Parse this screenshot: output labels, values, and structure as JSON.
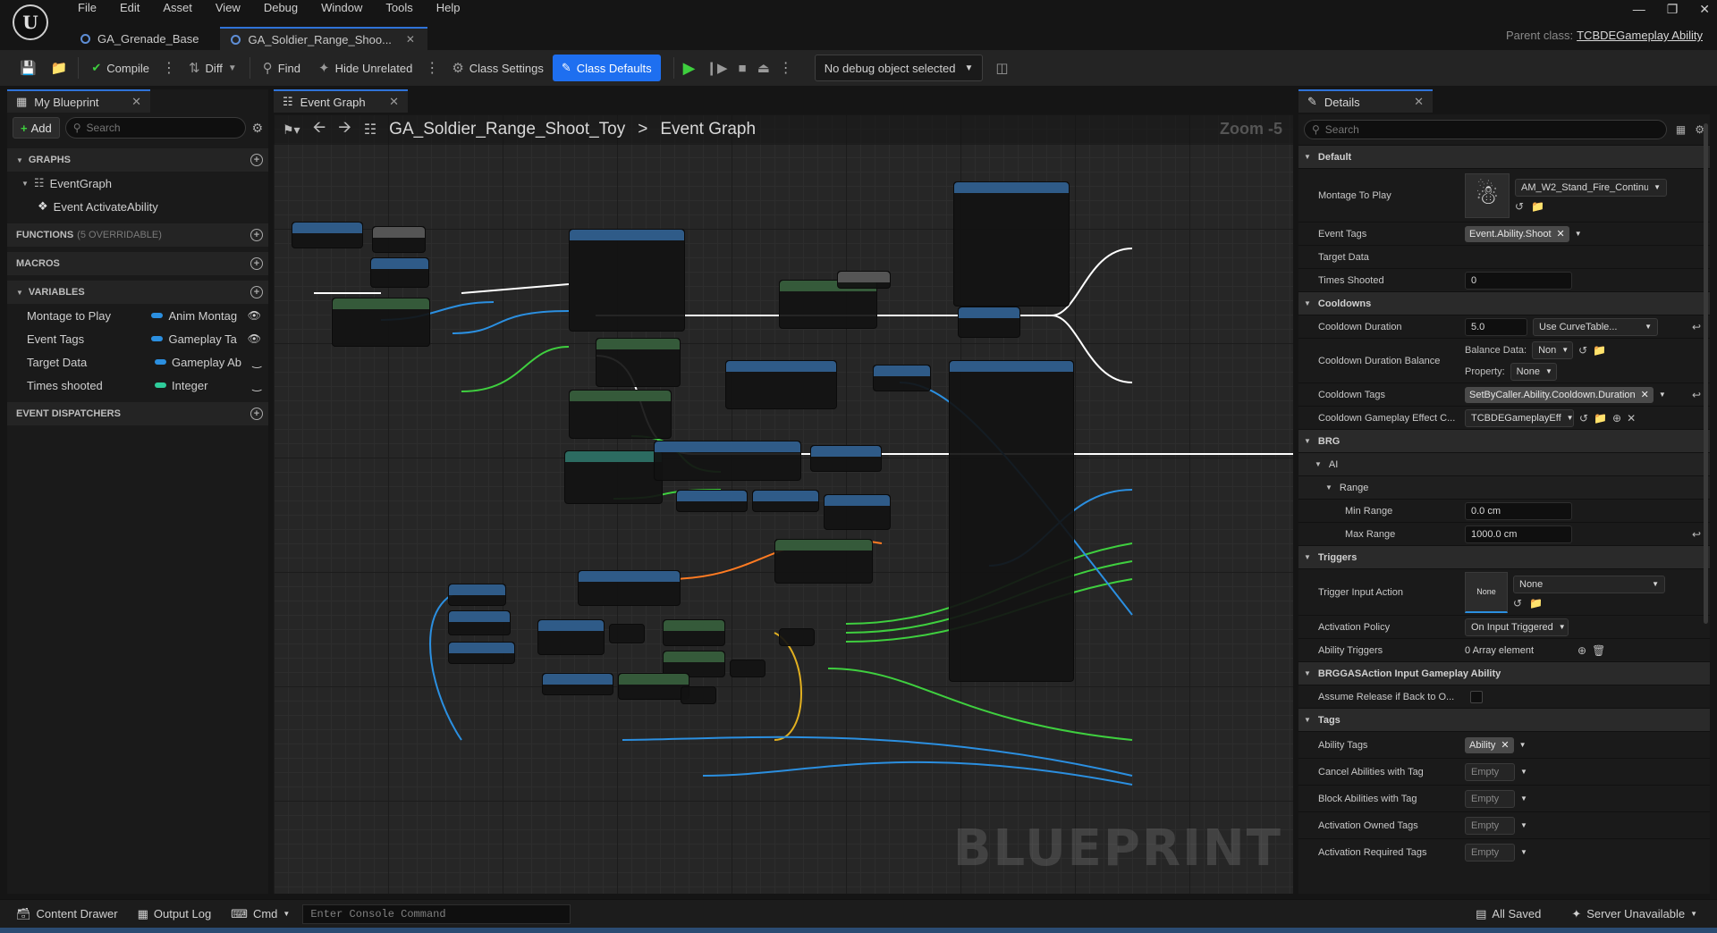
{
  "menu": {
    "logo": "U",
    "items": [
      "File",
      "Edit",
      "Asset",
      "View",
      "Debug",
      "Window",
      "Tools",
      "Help"
    ]
  },
  "tabs": [
    {
      "label": "GA_Grenade_Base"
    },
    {
      "label": "GA_Soldier_Range_Shoo..."
    }
  ],
  "parent_class": {
    "label": "Parent class:",
    "value": "TCBDEGameplay Ability"
  },
  "toolbar": {
    "compile": "Compile",
    "diff": "Diff",
    "find": "Find",
    "hide_unrelated": "Hide Unrelated",
    "class_settings": "Class Settings",
    "class_defaults": "Class Defaults",
    "debug_object": "No debug object selected"
  },
  "my_blueprint": {
    "tab_label": "My Blueprint",
    "add_label": "Add",
    "search_placeholder": "Search",
    "graphs_label": "GRAPHS",
    "event_graph": "EventGraph",
    "event_activate": "Event ActivateAbility",
    "functions_label": "FUNCTIONS",
    "functions_aux": "(5 OVERRIDABLE)",
    "macros_label": "MACROS",
    "variables_label": "VARIABLES",
    "variables": [
      {
        "name": "Montage to Play",
        "type": "Anim Montag",
        "color": "#2b8fe0"
      },
      {
        "name": "Event Tags",
        "type": "Gameplay Ta",
        "color": "#2b8fe0"
      },
      {
        "name": "Target Data",
        "type": "Gameplay Ab",
        "color": "#2b8fe0"
      },
      {
        "name": "Times shooted",
        "type": "Integer",
        "color": "#2ecc9a"
      }
    ],
    "dispatchers_label": "EVENT DISPATCHERS"
  },
  "graph": {
    "tab_label": "Event Graph",
    "breadcrumb_bp": "GA_Soldier_Range_Shoot_Toy",
    "breadcrumb_sep": ">",
    "breadcrumb_graph": "Event Graph",
    "zoom": "Zoom -5",
    "watermark": "BLUEPRINT"
  },
  "details": {
    "tab_label": "Details",
    "search_placeholder": "Search",
    "cat_default": "Default",
    "montage_label": "Montage To Play",
    "montage_value": "AM_W2_Stand_Fire_Continuc",
    "event_tags_label": "Event Tags",
    "event_tags_value": "Event.Ability.Shoot",
    "target_data_label": "Target Data",
    "times_shooted_label": "Times Shooted",
    "times_shooted_value": "0",
    "cat_cooldowns": "Cooldowns",
    "cooldown_duration_label": "Cooldown Duration",
    "cooldown_duration_value": "5.0",
    "cooldown_duration_mode": "Use CurveTable...",
    "cooldown_balance_label": "Cooldown Duration Balance",
    "balance_data_label": "Balance Data:",
    "balance_data_value": "Non",
    "property_label": "Property:",
    "property_value": "None",
    "cooldown_tags_label": "Cooldown Tags",
    "cooldown_tags_value": "SetByCaller.Ability.Cooldown.Duration",
    "cooldown_effect_label": "Cooldown Gameplay Effect C...",
    "cooldown_effect_value": "TCBDEGameplayEff",
    "cat_brg": "BRG",
    "cat_ai": "AI",
    "cat_range": "Range",
    "min_range_label": "Min Range",
    "min_range_value": "0.0 cm",
    "max_range_label": "Max Range",
    "max_range_value": "1000.0 cm",
    "cat_triggers": "Triggers",
    "trigger_input_label": "Trigger Input Action",
    "trigger_thumb": "None",
    "trigger_input_value": "None",
    "activation_policy_label": "Activation Policy",
    "activation_policy_value": "On Input Triggered",
    "ability_triggers_label": "Ability Triggers",
    "ability_triggers_value": "0 Array element",
    "cat_brgas": "BRGGASAction Input Gameplay Ability",
    "assume_release_label": "Assume Release if Back to O...",
    "cat_tags": "Tags",
    "ability_tags_label": "Ability Tags",
    "ability_tags_value": "Ability",
    "cancel_label": "Cancel Abilities with Tag",
    "block_label": "Block Abilities with Tag",
    "owned_label": "Activation Owned Tags",
    "required_label": "Activation Required Tags",
    "empty": "Empty"
  },
  "status": {
    "content_drawer": "Content Drawer",
    "output_log": "Output Log",
    "cmd": "Cmd",
    "console_placeholder": "Enter Console Command",
    "all_saved": "All Saved",
    "server": "Server Unavailable"
  }
}
